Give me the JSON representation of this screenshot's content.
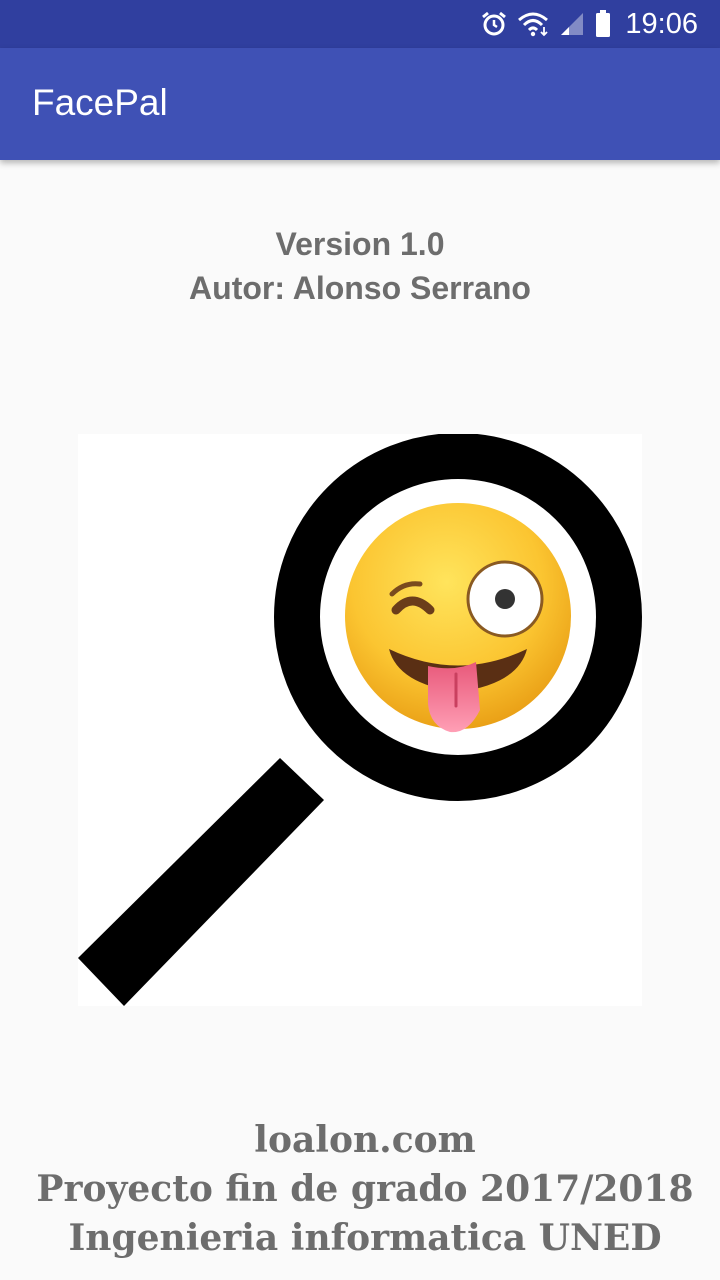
{
  "status_bar": {
    "time": "19:06",
    "icons": [
      "alarm-icon",
      "wifi-icon",
      "signal-icon",
      "battery-icon"
    ]
  },
  "app_bar": {
    "title": "FacePal"
  },
  "about": {
    "version": "Version 1.0",
    "author": "Autor: Alonso Serrano"
  },
  "logo": {
    "icon": "magnifier-winking-emoji-icon"
  },
  "footer": {
    "website": "loalon.com",
    "project": "Proyecto fin de grado 2017/2018",
    "degree": "Ingenieria informatica UNED"
  },
  "colors": {
    "status_bar": "#303f9f",
    "app_bar": "#3f51b5",
    "text_gray": "#6d6d6d",
    "background": "#fafafa"
  }
}
